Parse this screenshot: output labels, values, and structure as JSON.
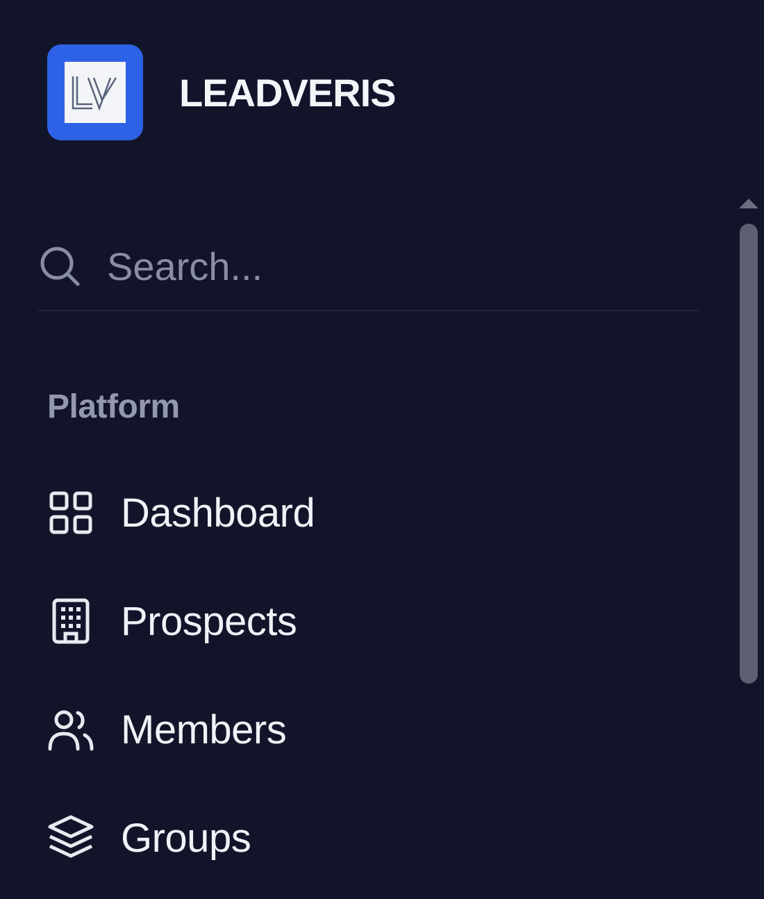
{
  "brand": {
    "logo_text": "LV",
    "name": "LEADVERIS",
    "accent_color": "#2e62e6"
  },
  "search": {
    "placeholder": "Search...",
    "value": "",
    "icon": "search-icon"
  },
  "section": {
    "label": "Platform"
  },
  "nav": {
    "items": [
      {
        "label": "Dashboard",
        "icon": "dashboard-grid-icon"
      },
      {
        "label": "Prospects",
        "icon": "building-icon"
      },
      {
        "label": "Members",
        "icon": "users-icon"
      },
      {
        "label": "Groups",
        "icon": "layers-icon"
      }
    ]
  },
  "colors": {
    "background": "#12152a",
    "text": "#f1f2f7",
    "muted": "#9498ad"
  }
}
